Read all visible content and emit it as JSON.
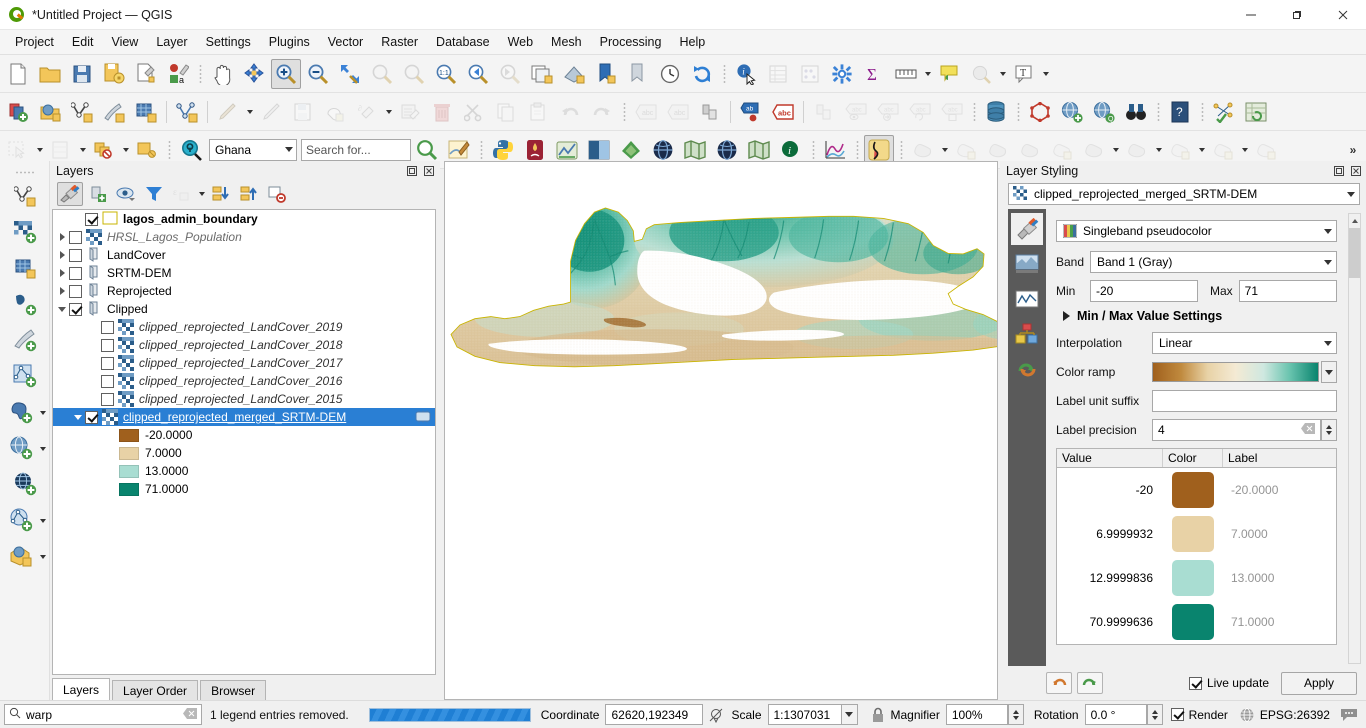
{
  "window": {
    "title": "*Untitled Project — QGIS",
    "app_icon": "qgis-logo-icon",
    "minimize": "–",
    "maximize": "❐",
    "close": "✕"
  },
  "menubar": {
    "items": [
      "Project",
      "Edit",
      "View",
      "Layer",
      "Settings",
      "Plugins",
      "Vector",
      "Raster",
      "Database",
      "Web",
      "Mesh",
      "Processing",
      "Help"
    ]
  },
  "toolbars": {
    "row1": [
      {
        "name": "new-project-icon",
        "kind": "icon",
        "enabled": true
      },
      {
        "name": "open-project-icon",
        "kind": "icon",
        "enabled": true,
        "framed": true
      },
      {
        "name": "save-project-icon",
        "kind": "icon",
        "enabled": true
      },
      {
        "name": "save-project-as-icon",
        "kind": "icon",
        "enabled": true
      },
      {
        "name": "new-print-layout-icon",
        "kind": "icon",
        "enabled": true
      },
      {
        "name": "style-manager-icon",
        "kind": "icon",
        "enabled": true
      },
      {
        "name": "separator"
      },
      {
        "name": "pan-map-icon",
        "kind": "icon",
        "enabled": true
      },
      {
        "name": "pan-to-selection-icon",
        "kind": "icon",
        "enabled": true
      },
      {
        "name": "zoom-in-icon",
        "kind": "icon",
        "enabled": true,
        "active": true
      },
      {
        "name": "zoom-out-icon",
        "kind": "icon",
        "enabled": true
      },
      {
        "name": "zoom-full-icon",
        "kind": "icon",
        "enabled": true
      },
      {
        "name": "zoom-to-selection-icon",
        "kind": "icon",
        "enabled": false
      },
      {
        "name": "zoom-to-layer-icon",
        "kind": "icon",
        "enabled": false
      },
      {
        "name": "zoom-native-icon",
        "kind": "icon",
        "enabled": true
      },
      {
        "name": "zoom-last-icon",
        "kind": "icon",
        "enabled": true
      },
      {
        "name": "zoom-next-icon",
        "kind": "icon",
        "enabled": false
      },
      {
        "name": "new-map-view-icon",
        "kind": "icon",
        "enabled": true
      },
      {
        "name": "new-3d-map-view-icon",
        "kind": "icon",
        "enabled": true
      },
      {
        "name": "refresh-bookmarks-icon",
        "kind": "icon",
        "enabled": true
      },
      {
        "name": "show-bookmarks-icon",
        "kind": "icon",
        "enabled": true
      },
      {
        "name": "temporal-controller-icon",
        "kind": "icon",
        "enabled": true
      },
      {
        "name": "refresh-icon",
        "kind": "icon",
        "enabled": true
      },
      {
        "name": "separator"
      },
      {
        "name": "identify-features-icon",
        "kind": "icon",
        "enabled": true
      },
      {
        "name": "open-attribute-table-icon",
        "kind": "icon",
        "enabled": false
      },
      {
        "name": "field-calculator-icon",
        "kind": "icon",
        "enabled": false
      },
      {
        "name": "processing-toolbox-icon",
        "kind": "icon",
        "enabled": true
      },
      {
        "name": "statistical-summary-icon",
        "kind": "icon",
        "enabled": true
      },
      {
        "name": "measure-line-icon",
        "kind": "icon",
        "enabled": true,
        "hasMenu": true
      },
      {
        "name": "map-tips-icon",
        "kind": "icon",
        "enabled": true
      },
      {
        "name": "select-features-icon",
        "kind": "icon",
        "enabled": false,
        "hasMenu": true
      },
      {
        "name": "text-annotation-icon",
        "kind": "icon",
        "enabled": true,
        "hasMenu": true
      }
    ],
    "row2": [
      {
        "name": "current-edits-icon",
        "kind": "icon",
        "enabled": true
      },
      {
        "name": "add-wms-layer-icon",
        "kind": "icon",
        "enabled": true
      },
      {
        "name": "add-vector-layer-icon",
        "kind": "icon",
        "enabled": true
      },
      {
        "name": "add-delimited-text-icon",
        "kind": "icon",
        "enabled": true
      },
      {
        "name": "add-mesh-layer-icon",
        "kind": "icon",
        "enabled": true
      },
      {
        "name": "divider"
      },
      {
        "name": "toggle-editing-icon",
        "kind": "icon",
        "enabled": true
      },
      {
        "name": "divider"
      },
      {
        "name": "add-feature-icon",
        "kind": "icon",
        "enabled": false,
        "hasMenu": true
      },
      {
        "name": "digitize-line-icon",
        "kind": "icon",
        "enabled": false
      },
      {
        "name": "save-layer-edits-icon",
        "kind": "icon",
        "enabled": false
      },
      {
        "name": "vertex-tool-icon",
        "kind": "icon",
        "enabled": false
      },
      {
        "name": "modify-attributes-icon",
        "kind": "icon",
        "enabled": false,
        "hasMenu": true
      },
      {
        "name": "multi-edit-icon",
        "kind": "icon",
        "enabled": false
      },
      {
        "name": "delete-selected-icon",
        "kind": "icon",
        "enabled": false
      },
      {
        "name": "cut-features-icon",
        "kind": "icon",
        "enabled": false
      },
      {
        "name": "copy-features-icon",
        "kind": "icon",
        "enabled": false
      },
      {
        "name": "paste-features-icon",
        "kind": "icon",
        "enabled": false
      },
      {
        "name": "undo-icon",
        "kind": "icon",
        "enabled": false
      },
      {
        "name": "redo-icon",
        "kind": "icon",
        "enabled": false
      },
      {
        "name": "separator"
      },
      {
        "name": "label-toolbar-abc-icon",
        "kind": "icon",
        "enabled": false
      },
      {
        "name": "label-abc-grey-icon",
        "kind": "icon",
        "enabled": false
      },
      {
        "name": "pin-labels-icon",
        "kind": "icon",
        "enabled": true
      },
      {
        "name": "divider"
      },
      {
        "name": "highlight-pinned-labels-icon",
        "kind": "icon",
        "enabled": true
      },
      {
        "name": "highlight-labels-red-icon",
        "kind": "icon",
        "enabled": true
      },
      {
        "name": "divider"
      },
      {
        "name": "move-label-icon",
        "kind": "icon",
        "enabled": false
      },
      {
        "name": "show-hide-labels-icon",
        "kind": "icon",
        "enabled": false
      },
      {
        "name": "change-label-icon",
        "kind": "icon",
        "enabled": false
      },
      {
        "name": "rotate-label-icon",
        "kind": "icon",
        "enabled": false
      },
      {
        "name": "label-properties-icon",
        "kind": "icon",
        "enabled": false
      },
      {
        "name": "separator"
      },
      {
        "name": "database-manager-icon",
        "kind": "icon",
        "enabled": true
      },
      {
        "name": "separator"
      },
      {
        "name": "georeferencer-icon",
        "kind": "icon",
        "enabled": true
      },
      {
        "name": "metasearch-add-icon",
        "kind": "icon",
        "enabled": true
      },
      {
        "name": "qgis-cloud-icon",
        "kind": "icon",
        "enabled": true
      },
      {
        "name": "metasearch-icon",
        "kind": "icon",
        "enabled": true
      },
      {
        "name": "separator"
      },
      {
        "name": "help-contents-icon",
        "kind": "icon",
        "enabled": true
      },
      {
        "name": "separator"
      },
      {
        "name": "topology-checker-icon",
        "kind": "icon",
        "enabled": true
      },
      {
        "name": "refresh-table-icon",
        "kind": "icon",
        "enabled": true
      }
    ],
    "row3": [
      {
        "name": "deselect-features-icon",
        "kind": "icon",
        "enabled": false,
        "hasMenu": true
      },
      {
        "name": "select-by-value-icon",
        "kind": "icon",
        "enabled": false,
        "hasMenu": true
      },
      {
        "name": "select-by-location-icon",
        "kind": "icon",
        "enabled": true,
        "hasMenu": true
      },
      {
        "name": "deselect-all-icon",
        "kind": "icon",
        "enabled": true
      },
      {
        "name": "separator"
      },
      {
        "name": "locator-search-icon",
        "kind": "icon",
        "enabled": true
      }
    ],
    "project_combo_value": "Ghana",
    "search_placeholder": "Search for...",
    "row3b": [
      {
        "name": "zoom-full-green-icon",
        "kind": "icon",
        "enabled": true
      },
      {
        "name": "map-styling-icon",
        "kind": "icon",
        "enabled": true
      },
      {
        "name": "separator"
      },
      {
        "name": "python-console-icon",
        "kind": "icon",
        "enabled": true
      },
      {
        "name": "freehand-raster-icon",
        "kind": "icon",
        "enabled": true
      },
      {
        "name": "data-plotly-icon",
        "kind": "icon",
        "enabled": true
      },
      {
        "name": "semi-automatic-classification-icon",
        "kind": "icon",
        "enabled": true
      },
      {
        "name": "qgis2web-icon",
        "kind": "icon",
        "enabled": true
      },
      {
        "name": "open-layers-icon",
        "kind": "icon",
        "enabled": true
      },
      {
        "name": "quickmapservices-icon",
        "kind": "icon",
        "enabled": true
      },
      {
        "name": "earth-globe-icon",
        "kind": "icon",
        "enabled": true
      },
      {
        "name": "mmqgis-icon",
        "kind": "icon",
        "enabled": true
      },
      {
        "name": "info-green-icon",
        "kind": "icon",
        "enabled": true
      },
      {
        "name": "separator"
      },
      {
        "name": "profile-tool-icon",
        "kind": "icon",
        "enabled": true
      },
      {
        "name": "separator"
      },
      {
        "name": "terrain-shading-icon",
        "kind": "icon",
        "enabled": true,
        "active": true
      },
      {
        "name": "separator"
      },
      {
        "name": "raster-calculator-icon",
        "kind": "icon",
        "enabled": false,
        "hasMenu": true
      },
      {
        "name": "align-raster-icon",
        "kind": "icon",
        "enabled": false
      },
      {
        "name": "clip-raster-icon",
        "kind": "icon",
        "enabled": false
      },
      {
        "name": "contour-icon",
        "kind": "icon",
        "enabled": false
      },
      {
        "name": "merge-raster-icon",
        "kind": "icon",
        "enabled": false
      },
      {
        "name": "raster-analysis-icon",
        "kind": "icon",
        "enabled": false,
        "hasMenu": true
      },
      {
        "name": "raster-conversion-icon",
        "kind": "icon",
        "enabled": false,
        "hasMenu": true
      },
      {
        "name": "raster-extraction-icon",
        "kind": "icon",
        "enabled": false,
        "hasMenu": true
      },
      {
        "name": "raster-projections-icon",
        "kind": "icon",
        "enabled": false,
        "hasMenu": true
      },
      {
        "name": "raster-misc-icon",
        "kind": "icon",
        "enabled": false
      }
    ],
    "overflow_label": "»"
  },
  "left_toolbar": {
    "items": [
      {
        "name": "add-vector-layer-icon",
        "hasMenu": false
      },
      {
        "name": "add-raster-layer-icon",
        "hasMenu": false
      },
      {
        "name": "add-mesh-layer-icon",
        "hasMenu": false
      },
      {
        "name": "add-delimited-text-layer-icon",
        "hasMenu": false
      },
      {
        "name": "add-spatialite-layer-icon",
        "hasMenu": false
      },
      {
        "name": "add-vector-tile-layer-icon",
        "hasMenu": false
      },
      {
        "name": "add-postgis-layer-icon",
        "hasMenu": true
      },
      {
        "name": "add-wms-wmts-layer-icon",
        "hasMenu": true
      },
      {
        "name": "add-wcs-layer-icon",
        "hasMenu": false
      },
      {
        "name": "add-wfs-layer-icon",
        "hasMenu": true
      },
      {
        "name": "new-virtual-layer-icon",
        "hasMenu": true
      }
    ]
  },
  "layers_panel": {
    "title": "Layers",
    "dock_float_icon": "float-panel-icon",
    "dock_close_icon": "close-panel-icon",
    "toolbar": [
      {
        "name": "open-layer-styling-panel-icon",
        "active": true
      },
      {
        "name": "add-group-icon",
        "active": false
      },
      {
        "name": "manage-layer-visibility-icon",
        "active": false
      },
      {
        "name": "filter-legend-icon",
        "active": false
      },
      {
        "name": "filter-legend-expression-icon",
        "active": false,
        "enabled": false,
        "hasMenu": true
      },
      {
        "name": "expand-all-icon",
        "active": false
      },
      {
        "name": "collapse-all-icon",
        "active": false
      },
      {
        "name": "remove-layer-icon",
        "active": false
      }
    ],
    "tree": [
      {
        "label": "lagos_admin_boundary",
        "indent": 1,
        "checked": true,
        "expander": "none",
        "icon": "polygon-outline-icon",
        "style": "bold"
      },
      {
        "label": "HRSL_Lagos_Population",
        "indent": 0,
        "checked": false,
        "expander": "right",
        "icon": "raster-icon",
        "style": "grayit"
      },
      {
        "label": "LandCover",
        "indent": 0,
        "checked": false,
        "expander": "right",
        "icon": "group-icon",
        "style": "plain"
      },
      {
        "label": "SRTM-DEM",
        "indent": 0,
        "checked": false,
        "expander": "right",
        "icon": "group-icon",
        "style": "plain"
      },
      {
        "label": "Reprojected",
        "indent": 0,
        "checked": false,
        "expander": "right",
        "icon": "group-icon",
        "style": "plain"
      },
      {
        "label": "Clipped",
        "indent": 0,
        "checked": true,
        "expander": "down",
        "icon": "group-icon",
        "style": "plain"
      },
      {
        "label": "clipped_reprojected_LandCover_2019",
        "indent": 2,
        "checked": false,
        "expander": "none",
        "icon": "raster-icon",
        "style": "italic"
      },
      {
        "label": "clipped_reprojected_LandCover_2018",
        "indent": 2,
        "checked": false,
        "expander": "none",
        "icon": "raster-icon",
        "style": "italic"
      },
      {
        "label": "clipped_reprojected_LandCover_2017",
        "indent": 2,
        "checked": false,
        "expander": "none",
        "icon": "raster-icon",
        "style": "italic"
      },
      {
        "label": "clipped_reprojected_LandCover_2016",
        "indent": 2,
        "checked": false,
        "expander": "none",
        "icon": "raster-icon",
        "style": "italic"
      },
      {
        "label": "clipped_reprojected_LandCover_2015",
        "indent": 2,
        "checked": false,
        "expander": "none",
        "icon": "raster-icon",
        "style": "italic"
      },
      {
        "label": "clipped_reprojected_merged_SRTM-DEM",
        "indent": 1,
        "checked": true,
        "expander": "down",
        "icon": "raster-icon",
        "style": "plain",
        "selected": true,
        "end_icon": "raster-indicator-icon"
      }
    ],
    "legend_entries": [
      {
        "label": "-20.0000",
        "color": "#a0601d"
      },
      {
        "label": "7.0000",
        "color": "#e8d2a6"
      },
      {
        "label": "13.0000",
        "color": "#a9ddd2"
      },
      {
        "label": "71.0000",
        "color": "#09846e"
      }
    ],
    "tabs": [
      {
        "label": "Layers",
        "active": true
      },
      {
        "label": "Layer Order",
        "active": false
      },
      {
        "label": "Browser",
        "active": false
      }
    ]
  },
  "layer_styling": {
    "title": "Layer Styling",
    "dock_float_icon": "float-panel-icon",
    "dock_close_icon": "close-panel-icon",
    "layer_combo_value": "clipped_reprojected_merged_SRTM-DEM",
    "icon_rail": [
      {
        "name": "symbology-brush-icon",
        "active": true
      },
      {
        "name": "transparency-icon",
        "active": false
      },
      {
        "name": "histogram-icon",
        "active": false
      },
      {
        "name": "rendering-icon",
        "active": false
      },
      {
        "name": "undo-redo-history-icon",
        "active": false
      }
    ],
    "renderer_label": "Singleband pseudocolor",
    "band_label": "Band",
    "band_value": "Band 1 (Gray)",
    "min_label": "Min",
    "min_value": "-20",
    "max_label": "Max",
    "max_value": "71",
    "minmax_settings_label": "Min / Max Value Settings",
    "interpolation_label": "Interpolation",
    "interpolation_value": "Linear",
    "color_ramp_label": "Color ramp",
    "color_ramp_stops": [
      "#a0601d",
      "#c08a3e",
      "#e8d2a6",
      "#f4ead4",
      "#cfe8e0",
      "#68c3ae",
      "#09846e"
    ],
    "label_unit_suffix_label": "Label unit suffix",
    "label_unit_suffix_value": "",
    "label_precision_label": "Label precision",
    "label_precision_value": "4",
    "table": {
      "headers": [
        "Value",
        "Color",
        "Label"
      ],
      "rows": [
        {
          "value": "-20",
          "color": "#a0601d",
          "label": "-20.0000"
        },
        {
          "value": "6.9999932",
          "color": "#e8d2a6",
          "label": "7.0000"
        },
        {
          "value": "12.9999836",
          "color": "#a9ddd2",
          "label": "13.0000"
        },
        {
          "value": "70.9999636",
          "color": "#09846e",
          "label": "71.0000"
        }
      ]
    },
    "undo_icon": "undo-icon",
    "redo_icon": "redo-icon",
    "live_update_label": "Live update",
    "live_update_checked": true,
    "apply_label": "Apply"
  },
  "statusbar": {
    "search_icon": "search-icon",
    "search_value": "warp",
    "clear_icon": "clear-icon",
    "message": "1 legend entries removed.",
    "coordinate_label": "Coordinate",
    "coordinate_value": "62620,192349",
    "extent_toggle_icon": "toggle-extents-icon",
    "scale_label": "Scale",
    "scale_value": "1:1307031",
    "lock_icon": "lock-scale-icon",
    "magnifier_label": "Magnifier",
    "magnifier_value": "100%",
    "rotation_label": "Rotation",
    "rotation_value": "0.0 °",
    "render_label": "Render",
    "render_checked": true,
    "crs_icon": "crs-globe-icon",
    "crs_label": "EPSG:26392",
    "messages_icon": "messages-icon"
  },
  "map": {
    "background": "#ffffff",
    "boundary_color": "#c8b400",
    "dem_low_color": "#d8b98a",
    "dem_mid_color": "#e8d2a6",
    "dem_high_color": "#09846e"
  }
}
